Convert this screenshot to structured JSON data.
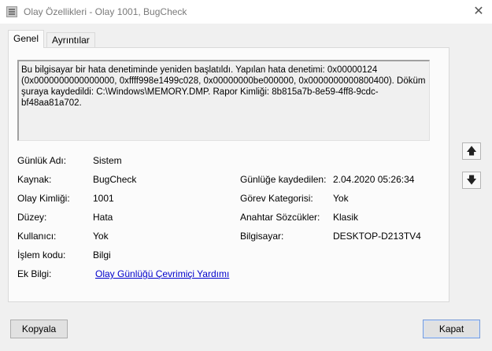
{
  "window": {
    "title": "Olay Özellikleri - Olay 1001, BugCheck",
    "close_glyph": "✕"
  },
  "tabs": [
    {
      "label": "Genel",
      "active": true
    },
    {
      "label": "Ayrıntılar",
      "active": false
    }
  ],
  "description": "Bu bilgisayar bir hata denetiminde yeniden başlatıldı. Yapılan hata denetimi: 0x00000124 (0x0000000000000000, 0xffff998e1499c028, 0x00000000be000000, 0x0000000000800400). Döküm şuraya kaydedildi: C:\\Windows\\MEMORY.DMP. Rapor Kimliği: 8b815a7b-8e59-4ff8-9cdc-bf48aa81a702.",
  "fields": {
    "log_name": {
      "label": "Günlük Adı:",
      "value": "Sistem"
    },
    "source": {
      "label": "Kaynak:",
      "value": "BugCheck"
    },
    "logged": {
      "label": "Günlüğe kaydedilen:",
      "value": "2.04.2020 05:26:34"
    },
    "event_id": {
      "label": "Olay Kimliği:",
      "value": "1001"
    },
    "task_category": {
      "label": "Görev Kategorisi:",
      "value": "Yok"
    },
    "level": {
      "label": "Düzey:",
      "value": "Hata"
    },
    "keywords": {
      "label": "Anahtar Sözcükler:",
      "value": "Klasik"
    },
    "user": {
      "label": "Kullanıcı:",
      "value": "Yok"
    },
    "computer": {
      "label": "Bilgisayar:",
      "value": "DESKTOP-D213TV4"
    },
    "opcode": {
      "label": "İşlem kodu:",
      "value": "Bilgi"
    },
    "more_info": {
      "label": "Ek Bilgi:",
      "link": "Olay Günlüğü Çevrimiçi Yardımı"
    }
  },
  "nav": {
    "up_glyph": "🡅",
    "down_glyph": "🡇"
  },
  "buttons": {
    "copy": "Kopyala",
    "close": "Kapat"
  }
}
